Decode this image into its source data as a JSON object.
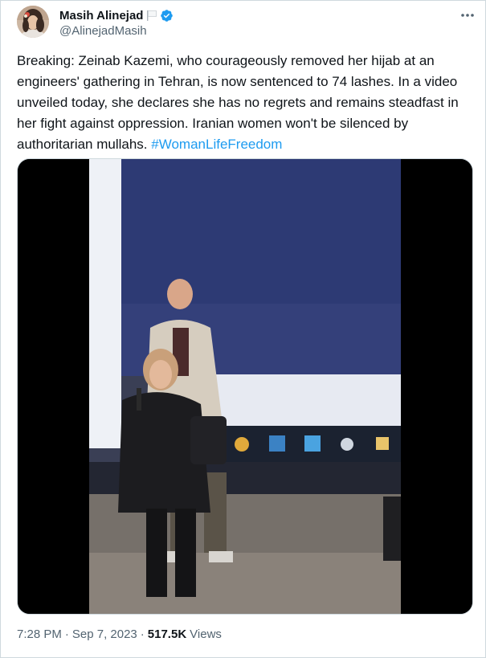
{
  "author": {
    "display_name": "Masih Alinejad",
    "handle": "@AlinejadMasih",
    "verified": true,
    "badge_icon": "verified-icon",
    "flag_icon": "white-flag-icon",
    "accent_color": "#1d9bf0"
  },
  "more_options_icon": "ellipsis-icon",
  "tweet": {
    "text": "Breaking: Zeinab Kazemi, who courageously removed her hijab at an engineers' gathering in Tehran, is now sentenced to 74 lashes. In a video unveiled today, she declares she has no regrets and remains steadfast in her fight against oppression. Iranian women won't be silenced by authoritarian mullahs.",
    "hashtag": "#WomanLifeFreedom"
  },
  "meta": {
    "time": "7:28 PM",
    "separator": "·",
    "date": "Sep 7, 2023",
    "views_count": "517.5K",
    "views_label": "Views"
  }
}
